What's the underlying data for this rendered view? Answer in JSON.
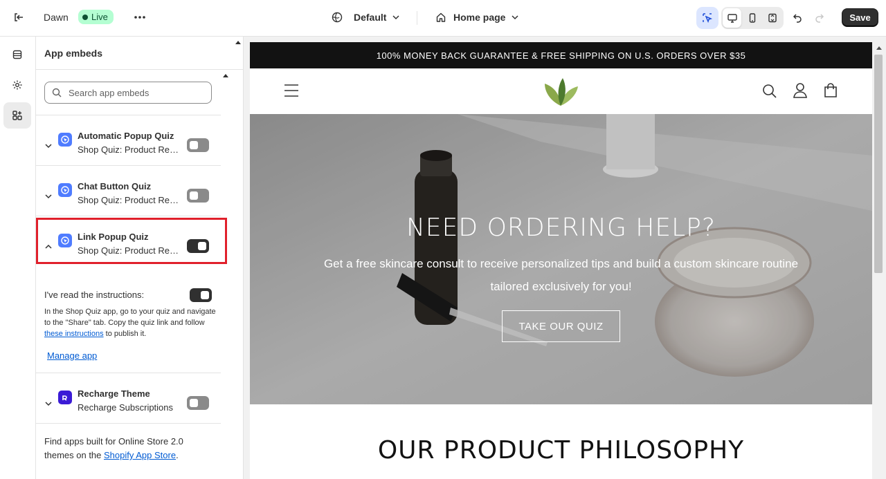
{
  "topbar": {
    "theme_name": "Dawn",
    "live_badge": "Live",
    "template_dropdown": "Default",
    "page_dropdown": "Home page",
    "save_label": "Save"
  },
  "panel": {
    "title": "App embeds",
    "search_placeholder": "Search app embeds",
    "embeds": [
      {
        "name": "Automatic Popup Quiz",
        "subtitle": "Shop Quiz: Product Recommendation",
        "enabled": false,
        "expanded": false
      },
      {
        "name": "Chat Button Quiz",
        "subtitle": "Shop Quiz: Product Recommendation",
        "enabled": false,
        "expanded": false
      },
      {
        "name": "Link Popup Quiz",
        "subtitle": "Shop Quiz: Product Recommendation",
        "enabled": true,
        "expanded": true
      },
      {
        "name": "Recharge Theme",
        "subtitle": "Recharge Subscriptions",
        "enabled": false,
        "expanded": false
      }
    ],
    "instructions": {
      "label": "I've read the instructions:",
      "text_before": "In the Shop Quiz app, go to your quiz and navigate to the \"Share\" tab. Copy the quiz link and follow ",
      "link_text": "these instructions",
      "text_after": " to publish it.",
      "manage_link": "Manage app"
    },
    "footer": {
      "text_before": "Find apps built for Online Store 2.0 themes on the ",
      "link_text": "Shopify App Store",
      "text_after": "."
    }
  },
  "preview": {
    "announcement": "100% MONEY BACK GUARANTEE & FREE SHIPPING ON U.S. ORDERS OVER $35",
    "hero_title": "NEED ORDERING HELP?",
    "hero_subtitle": "Get a free skincare consult to receive personalized tips and build a custom skincare routine tailored exclusively for you!",
    "hero_button": "TAKE OUR QUIZ",
    "section_title": "OUR PRODUCT PHILOSOPHY"
  },
  "colors": {
    "live_bg": "#b4fed2",
    "highlight": "#e0202b",
    "link": "#005bd3",
    "app_icon": "#4f7cff",
    "recharge_icon": "#3b1bd6"
  }
}
